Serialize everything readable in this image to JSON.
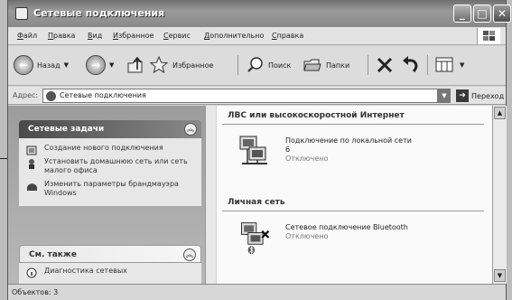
{
  "window": {
    "title": "Сетевые подключения"
  },
  "menu": [
    "Файл",
    "Правка",
    "Вид",
    "Избранное",
    "Сервис",
    "Дополнительно",
    "Справка"
  ],
  "toolbar": {
    "back": "Назад",
    "favorites": "Избранное",
    "search": "Поиск",
    "folders": "Папки"
  },
  "address": {
    "label": "Адрес:",
    "value": "Сетевые подключения",
    "go": "Переход"
  },
  "tasks": {
    "title": "Сетевые задачи",
    "items": [
      "Создание нового подключения",
      "Установить домашнюю сеть или сеть малого офиса",
      "Изменить параметры брандмауэра Windows"
    ]
  },
  "see_also": {
    "title": "См. также",
    "items": [
      "Диагностика сетевых"
    ]
  },
  "groups": [
    {
      "title": "ЛВС или высокоскоростной Интернет",
      "item": {
        "name": "Подключение по локальной сети 6",
        "status": "Отключено"
      }
    },
    {
      "title": "Личная сеть",
      "item": {
        "name": "Сетевое подключение Bluetooth",
        "status": "Отключено"
      }
    }
  ],
  "status": {
    "text": "Объектов: 3"
  }
}
